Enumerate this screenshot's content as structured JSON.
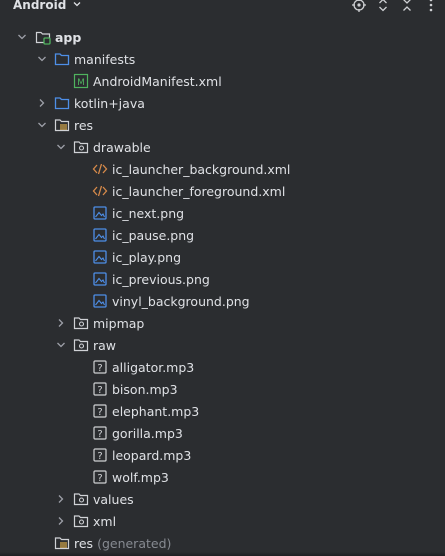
{
  "header": {
    "title": "Android",
    "icons": [
      "chevron-down-icon",
      "target-icon",
      "expand-collapse-icon",
      "close-collapse-icon",
      "more-vertical-icon"
    ]
  },
  "tree": {
    "app": "app",
    "manifests": "manifests",
    "android_manifest": "AndroidManifest.xml",
    "kotlin_java": "kotlin+java",
    "res": "res",
    "drawable": "drawable",
    "drawable_files": [
      "ic_launcher_background.xml",
      "ic_launcher_foreground.xml",
      "ic_next.png",
      "ic_pause.png",
      "ic_play.png",
      "ic_previous.png",
      "vinyl_background.png"
    ],
    "mipmap": "mipmap",
    "raw": "raw",
    "raw_files": [
      "alligator.mp3",
      "bison.mp3",
      "elephant.mp3",
      "gorilla.mp3",
      "leopard.mp3",
      "wolf.mp3"
    ],
    "values": "values",
    "xml": "xml",
    "res_generated": "res",
    "res_generated_suffix": "(generated)"
  },
  "colors": {
    "background": "#2b2d30",
    "text": "#dfe1e5",
    "muted": "#868a91",
    "folder_blue": "#4e8fe8",
    "manifest_green": "#4fb35e",
    "xml_orange": "#d78a4a"
  }
}
